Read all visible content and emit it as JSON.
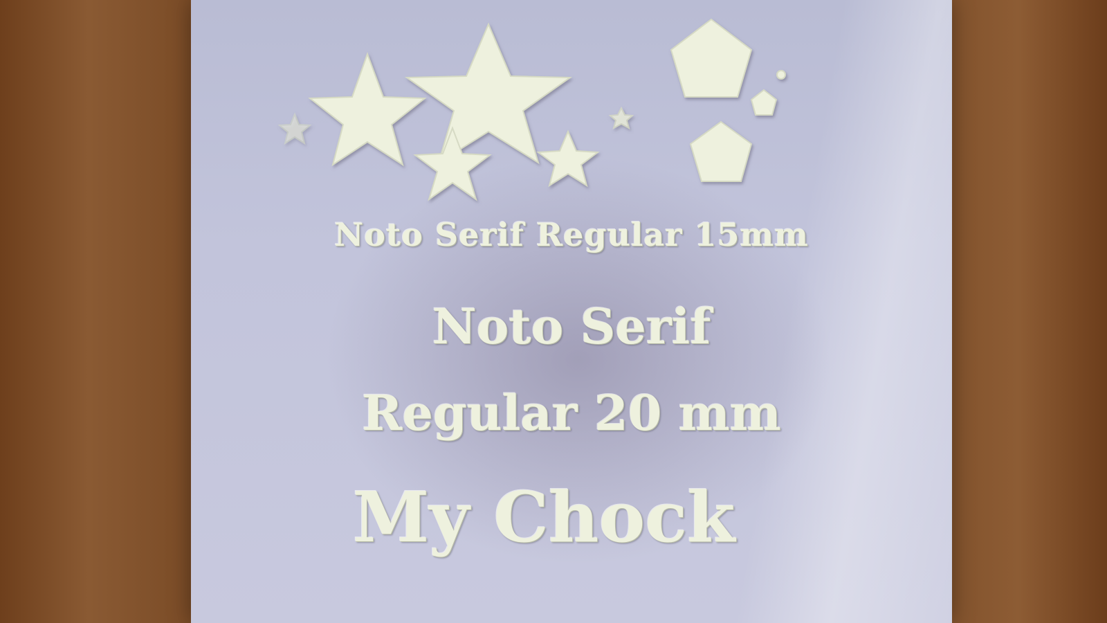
{
  "photo": {
    "background_color": "#7a4a25",
    "paper_color": "#c2c4db",
    "ink_color": "#eef1de",
    "text_lines": {
      "line_1": "Noto Serif Regular 15mm",
      "line_2": "Noto Serif",
      "line_3": "Regular 20 mm",
      "line_4": "My Chock"
    },
    "shapes": {
      "stars": 6,
      "pentagons": 3
    }
  }
}
